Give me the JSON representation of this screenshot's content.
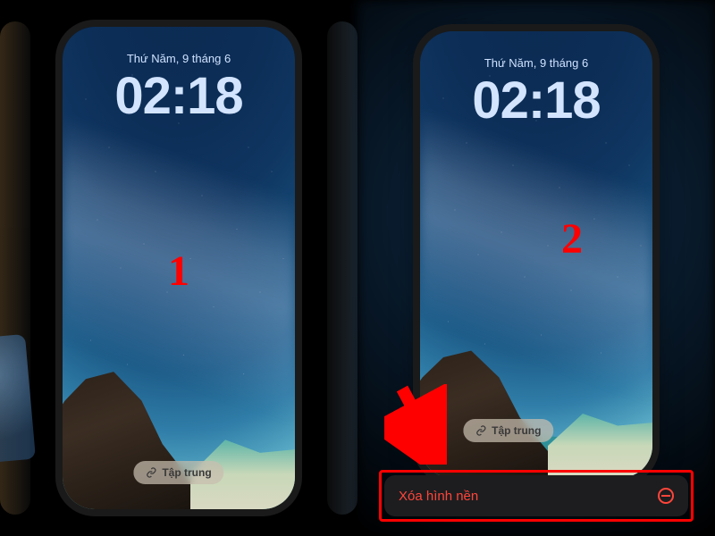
{
  "step1": {
    "number": "1",
    "date": "Thứ Năm, 9 tháng 6",
    "time": "02:18",
    "focus_label": "Tập trung"
  },
  "step2": {
    "number": "2",
    "date": "Thứ Năm, 9 tháng 6",
    "time": "02:18",
    "focus_label": "Tập trung",
    "delete_label": "Xóa hình nền",
    "delete_icon": "minus-circle-icon"
  },
  "colors": {
    "annotation_red": "#ff0000",
    "ios_destructive": "#ff453a",
    "time_text": "#d3e4ff"
  }
}
